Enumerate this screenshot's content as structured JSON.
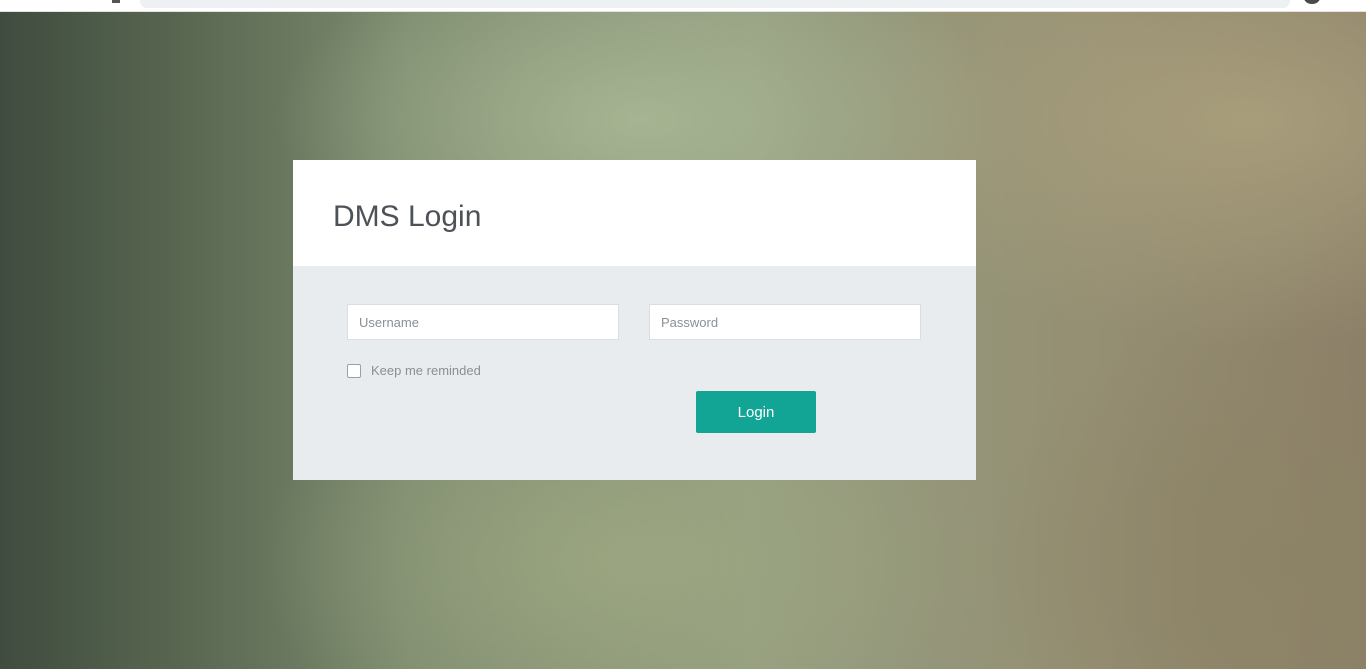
{
  "page": {
    "title": "DMS Login"
  },
  "form": {
    "username_placeholder": "Username",
    "username_value": "",
    "password_placeholder": "Password",
    "password_value": "",
    "remember_label": "Keep me reminded",
    "remember_checked": false,
    "login_label": "Login"
  },
  "colors": {
    "accent": "#12a596",
    "card_body": "#e9ecef",
    "card_header": "#ffffff",
    "title_text": "#4d5158"
  },
  "icons": {
    "browser_page": "document-icon",
    "browser_profile": "avatar-icon"
  }
}
